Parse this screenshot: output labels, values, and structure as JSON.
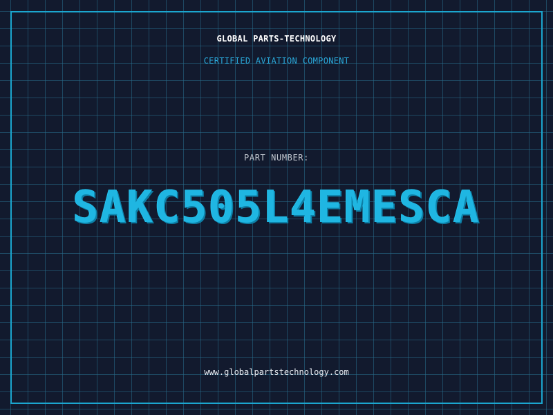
{
  "header": {
    "company": "GLOBAL PARTS-TECHNOLOGY",
    "subtitle": "CERTIFIED AVIATION COMPONENT"
  },
  "part": {
    "label": "PART NUMBER:",
    "number": "SAKC505L4EMESCA"
  },
  "footer": {
    "website": "www.globalpartstechnology.com"
  },
  "colors": {
    "background": "#121a2e",
    "grid": "#286e8c",
    "accent": "#1fb6e2",
    "border": "#1ba6cf"
  }
}
